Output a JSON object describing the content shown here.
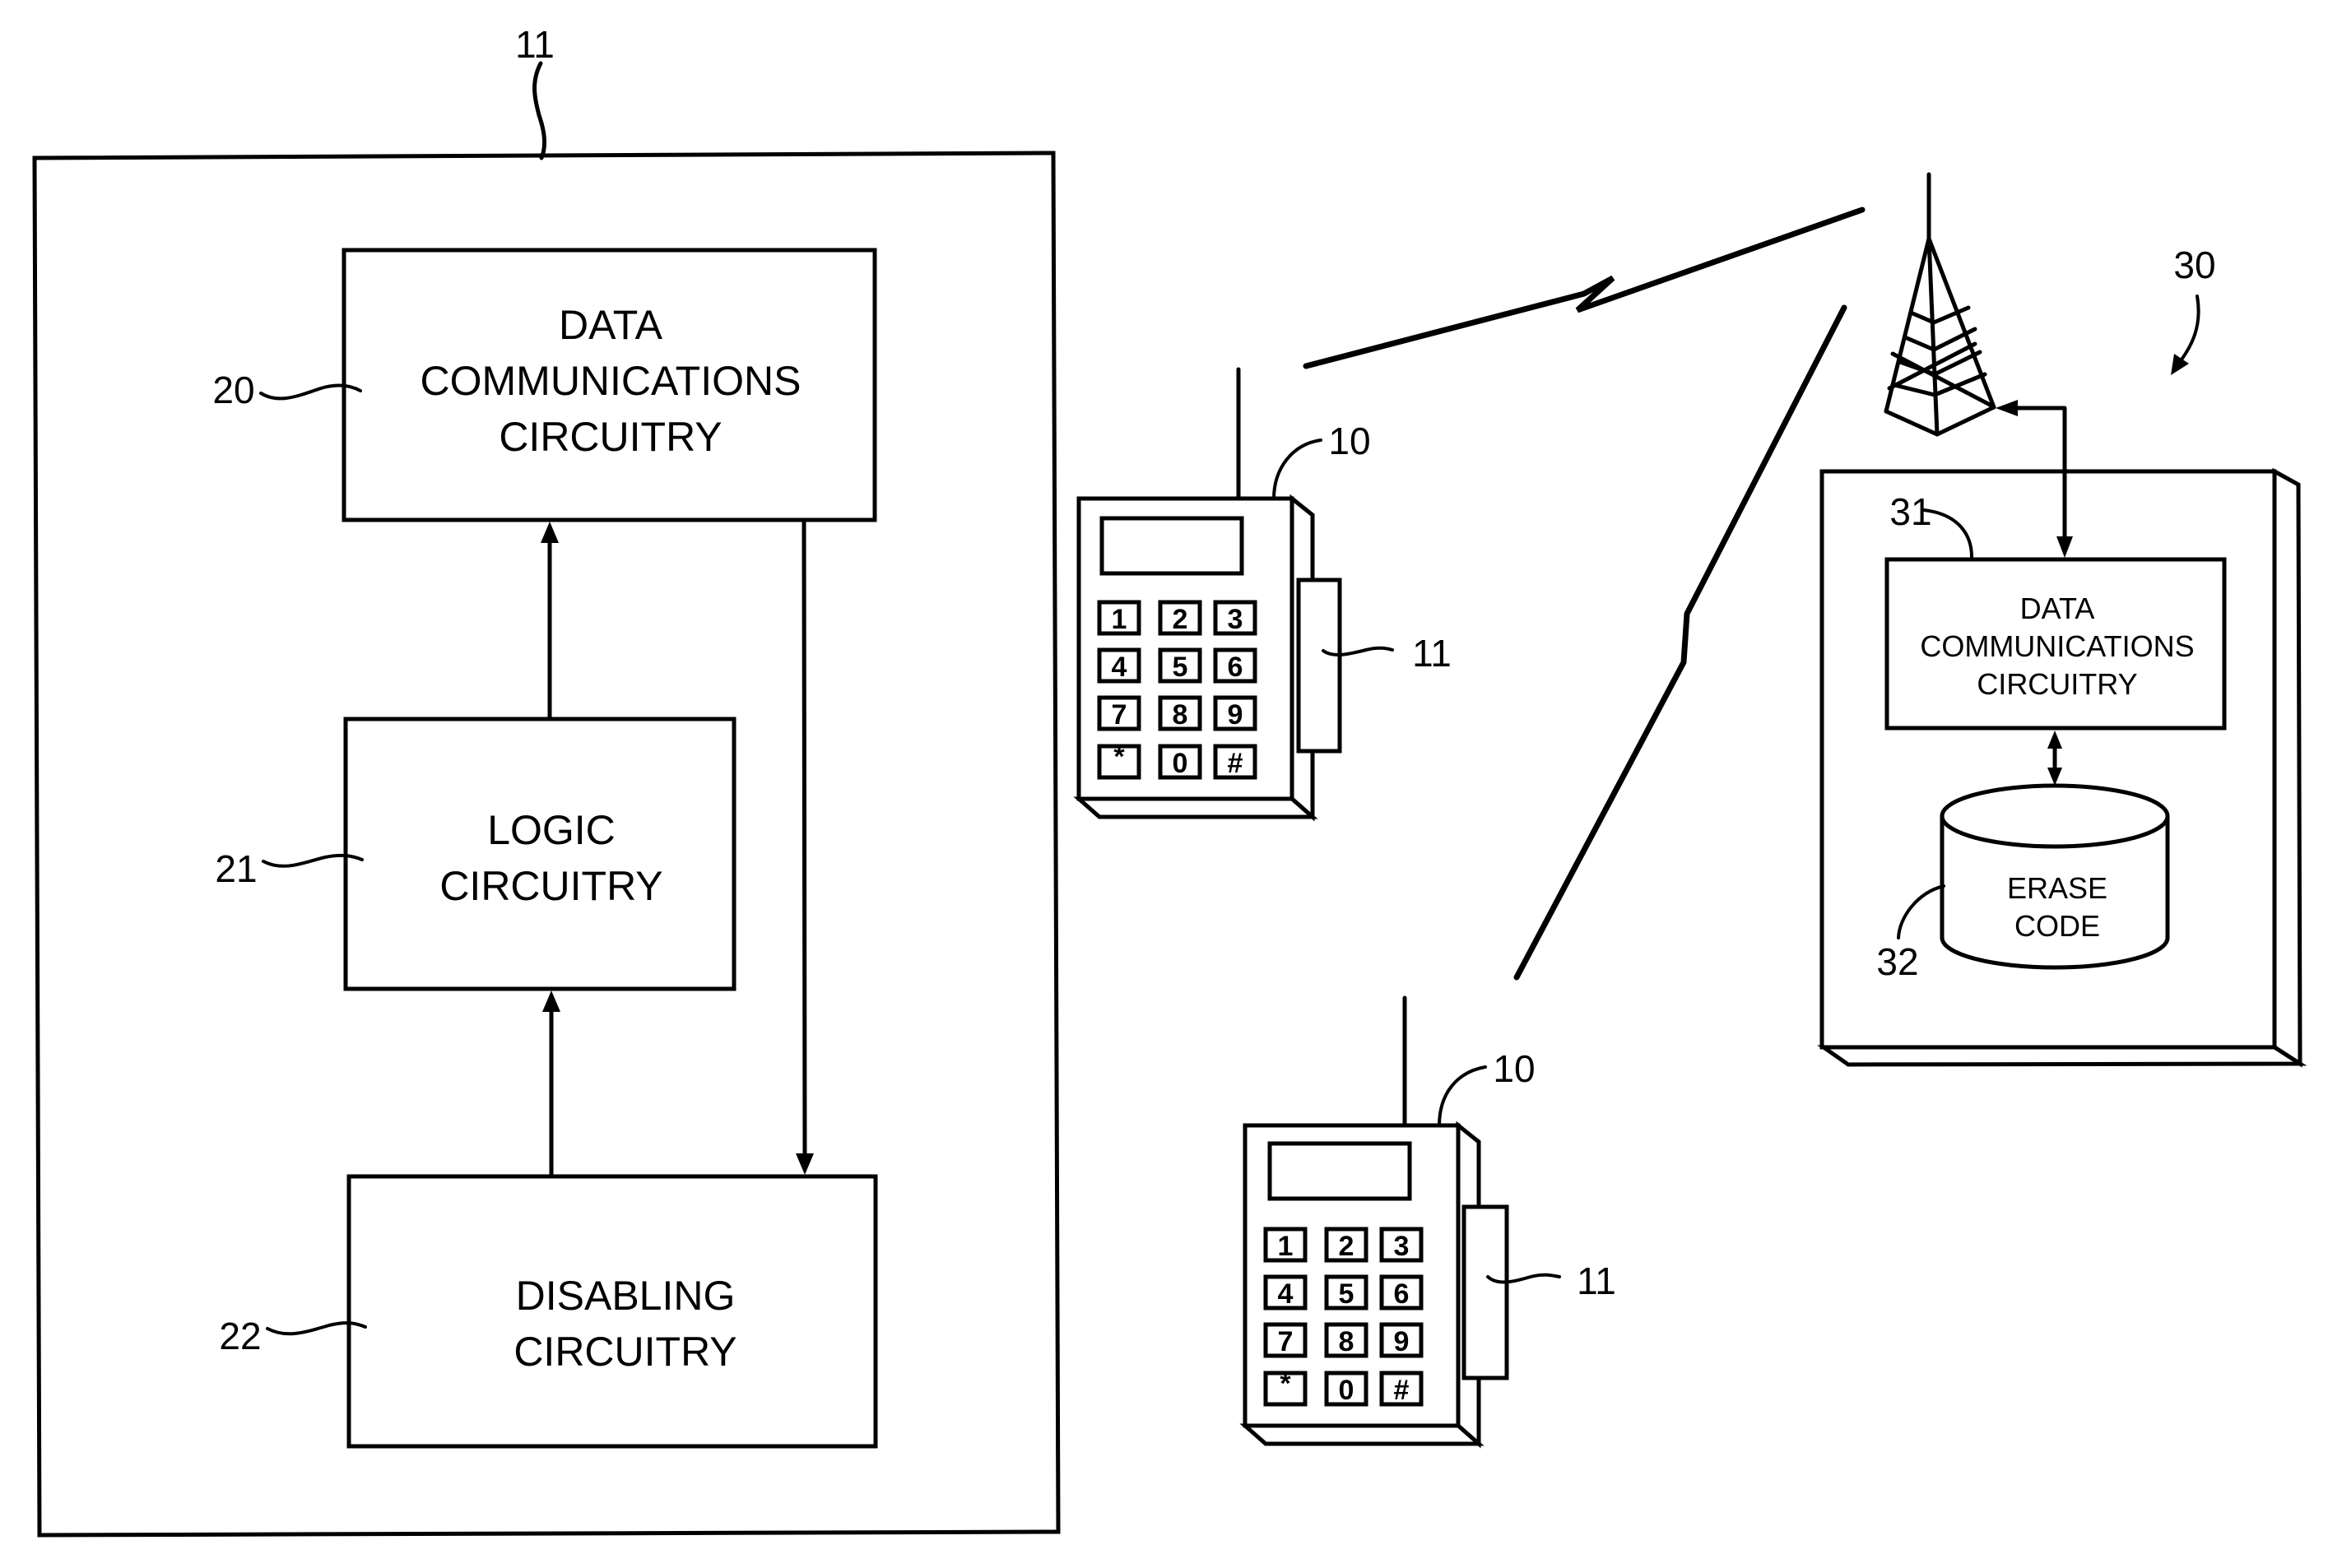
{
  "figure": {
    "device_module": {
      "ref": "11",
      "blocks": [
        {
          "ref": "20",
          "lines": [
            "DATA",
            "COMMUNICATIONS",
            "CIRCUITRY"
          ]
        },
        {
          "ref": "21",
          "lines": [
            "LOGIC",
            "CIRCUITRY"
          ]
        },
        {
          "ref": "22",
          "lines": [
            "DISABLING",
            "CIRCUITRY"
          ]
        }
      ]
    },
    "handsets": [
      {
        "ref": "10",
        "module_ref": "11"
      },
      {
        "ref": "10",
        "module_ref": "11"
      }
    ],
    "keypad": [
      "1",
      "2",
      "3",
      "4",
      "5",
      "6",
      "7",
      "8",
      "9",
      "*",
      "0",
      "#"
    ],
    "server": {
      "ref": "30",
      "comm_block": {
        "ref": "31",
        "lines": [
          "DATA",
          "COMMUNICATIONS",
          "CIRCUITRY"
        ]
      },
      "database": {
        "ref": "32",
        "lines": [
          "ERASE",
          "CODE"
        ]
      }
    },
    "tower": {
      "icon": "antenna-tower-icon"
    },
    "links": [
      {
        "icon": "wireless-link-icon",
        "from": "handset-1",
        "to": "tower"
      },
      {
        "icon": "wireless-link-icon",
        "from": "handset-2",
        "to": "tower"
      }
    ]
  }
}
